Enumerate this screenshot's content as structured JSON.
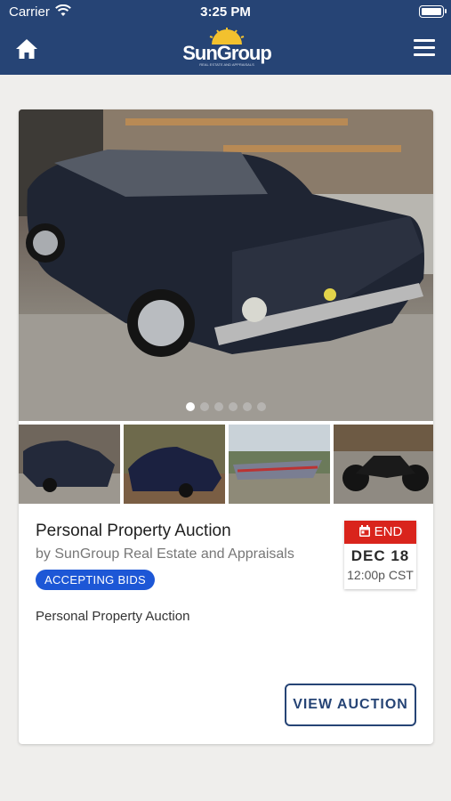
{
  "status_bar": {
    "carrier": "Carrier",
    "time": "3:25 PM"
  },
  "nav": {
    "logo_text": "SunGroup",
    "logo_subtitle": "REAL ESTATE AND APPRAISALS"
  },
  "gallery": {
    "slide_count": 6,
    "active_slide": 1
  },
  "auction": {
    "title": "Personal Property Auction",
    "byline": "by SunGroup Real Estate and Appraisals",
    "status_badge": "ACCEPTING BIDS",
    "description": "Personal Property Auction",
    "end_label": "END",
    "end_date": "DEC 18",
    "end_time": "12:00p CST",
    "view_button": "VIEW AUCTION"
  },
  "colors": {
    "nav_blue": "#264475",
    "badge_blue": "#1d57d6",
    "end_red": "#d9241c"
  }
}
